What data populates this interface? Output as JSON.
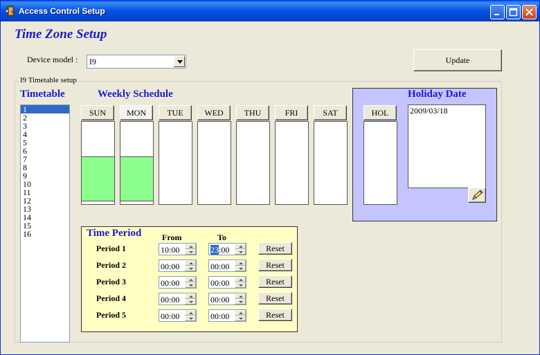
{
  "window": {
    "title": "Access Control Setup"
  },
  "heading": "Time Zone Setup",
  "device": {
    "label": "Device model :",
    "value": "I9"
  },
  "update_label": "Update",
  "group_title": "I9 Timetable setup",
  "timetable": {
    "heading": "Timetable",
    "items": [
      "1",
      "2",
      "3",
      "4",
      "5",
      "6",
      "7",
      "8",
      "9",
      "10",
      "11",
      "12",
      "13",
      "14",
      "15",
      "16"
    ],
    "selected": "1"
  },
  "weekly": {
    "heading": "Weekly Schedule",
    "days": [
      {
        "label": "SUN",
        "fill_start": 0.42,
        "fill_end": 0.97
      },
      {
        "label": "MON",
        "fill_start": 0.42,
        "fill_end": 0.97
      },
      {
        "label": "TUE",
        "fill_start": null,
        "fill_end": null
      },
      {
        "label": "WED",
        "fill_start": null,
        "fill_end": null
      },
      {
        "label": "THU",
        "fill_start": null,
        "fill_end": null
      },
      {
        "label": "FRI",
        "fill_start": null,
        "fill_end": null
      },
      {
        "label": "SAT",
        "fill_start": null,
        "fill_end": null
      }
    ],
    "active_day": "MON",
    "fill_color": "#8cff8c"
  },
  "holiday": {
    "heading": "Holiday Date",
    "hol_label": "HOL",
    "dates": [
      "2009/03/18"
    ],
    "panel_color": "#c4c4ff",
    "edit_icon": "pencil-icon"
  },
  "time_period": {
    "heading": "Time Period",
    "from_label": "From",
    "to_label": "To",
    "panel_color": "#ffffc4",
    "periods": [
      {
        "label": "Period 1",
        "from": "10:00",
        "to_h": "23",
        "to_m": ":00",
        "reset": "Reset"
      },
      {
        "label": "Period 2",
        "from": "00:00",
        "to": "00:00",
        "reset": "Reset"
      },
      {
        "label": "Period 3",
        "from": "00:00",
        "to": "00:00",
        "reset": "Reset"
      },
      {
        "label": "Period 4",
        "from": "00:00",
        "to": "00:00",
        "reset": "Reset"
      },
      {
        "label": "Period 5",
        "from": "00:00",
        "to": "00:00",
        "reset": "Reset"
      }
    ]
  },
  "accent_color": "#1a1ad2"
}
